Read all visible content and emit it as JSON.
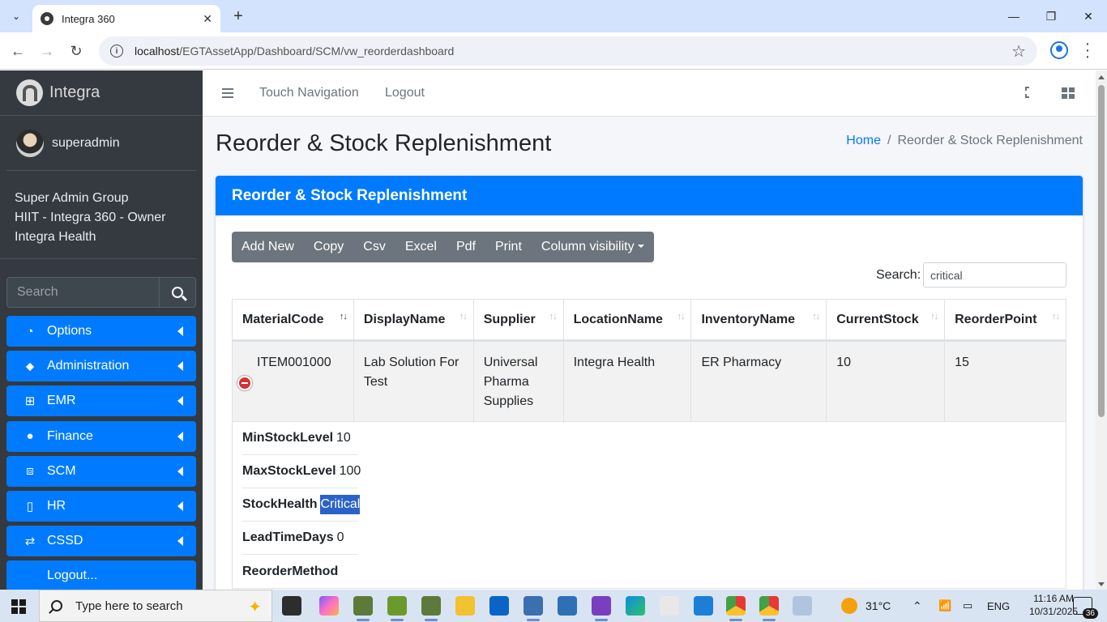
{
  "browser": {
    "tab_title": "Integra 360",
    "url_host": "localhost",
    "url_path": "/EGTAssetApp/Dashboard/SCM/vw_reorderdashboard"
  },
  "sidebar": {
    "brand": "Integra",
    "user_name": "superadmin",
    "groups": [
      "Super Admin Group",
      "HIIT - Integra 360 - Owner",
      "Integra Health"
    ],
    "search_placeholder": "Search",
    "items": [
      {
        "label": "Options",
        "icon": "dashboard-gauge-icon"
      },
      {
        "label": "Administration",
        "icon": "tags-icon"
      },
      {
        "label": "EMR",
        "icon": "sitemap-icon"
      },
      {
        "label": "Finance",
        "icon": "users-icon"
      },
      {
        "label": "SCM",
        "icon": "cubes-icon"
      },
      {
        "label": "HR",
        "icon": "file-icon"
      },
      {
        "label": "CSSD",
        "icon": "exchange-icon"
      },
      {
        "label": "Logout..."
      }
    ]
  },
  "topnav": {
    "touch_navigation": "Touch Navigation",
    "logout": "Logout"
  },
  "page": {
    "title": "Reorder & Stock Replenishment",
    "breadcrumb_home": "Home",
    "breadcrumb_sep": "/",
    "breadcrumb_current": "Reorder & Stock Replenishment",
    "card_title": "Reorder & Stock Replenishment"
  },
  "toolbar": {
    "buttons": [
      "Add New",
      "Copy",
      "Csv",
      "Excel",
      "Pdf",
      "Print"
    ],
    "column_visibility": "Column visibility"
  },
  "search": {
    "label": "Search:",
    "value": "critical"
  },
  "table": {
    "columns": [
      "MaterialCode",
      "DisplayName",
      "Supplier",
      "LocationName",
      "InventoryName",
      "CurrentStock",
      "ReorderPoint"
    ],
    "rows": [
      {
        "MaterialCode": "ITEM001000",
        "DisplayName": "Lab Solution For Test",
        "Supplier": "Universal Pharma Supplies",
        "LocationName": "Integra Health",
        "InventoryName": "ER Pharmacy",
        "CurrentStock": "10",
        "ReorderPoint": "15"
      }
    ],
    "details": [
      {
        "label": "MinStockLevel",
        "value": "10"
      },
      {
        "label": "MaxStockLevel",
        "value": "100"
      },
      {
        "label": "StockHealth",
        "value": "Critical"
      },
      {
        "label": "LeadTimeDays",
        "value": "0"
      },
      {
        "label": "ReorderMethod",
        "value": ""
      }
    ]
  },
  "taskbar": {
    "search_placeholder": "Type here to search",
    "temperature": "31°C",
    "language": "ENG",
    "time": "11:16 AM",
    "date": "10/31/2025",
    "notification_count": "36"
  }
}
